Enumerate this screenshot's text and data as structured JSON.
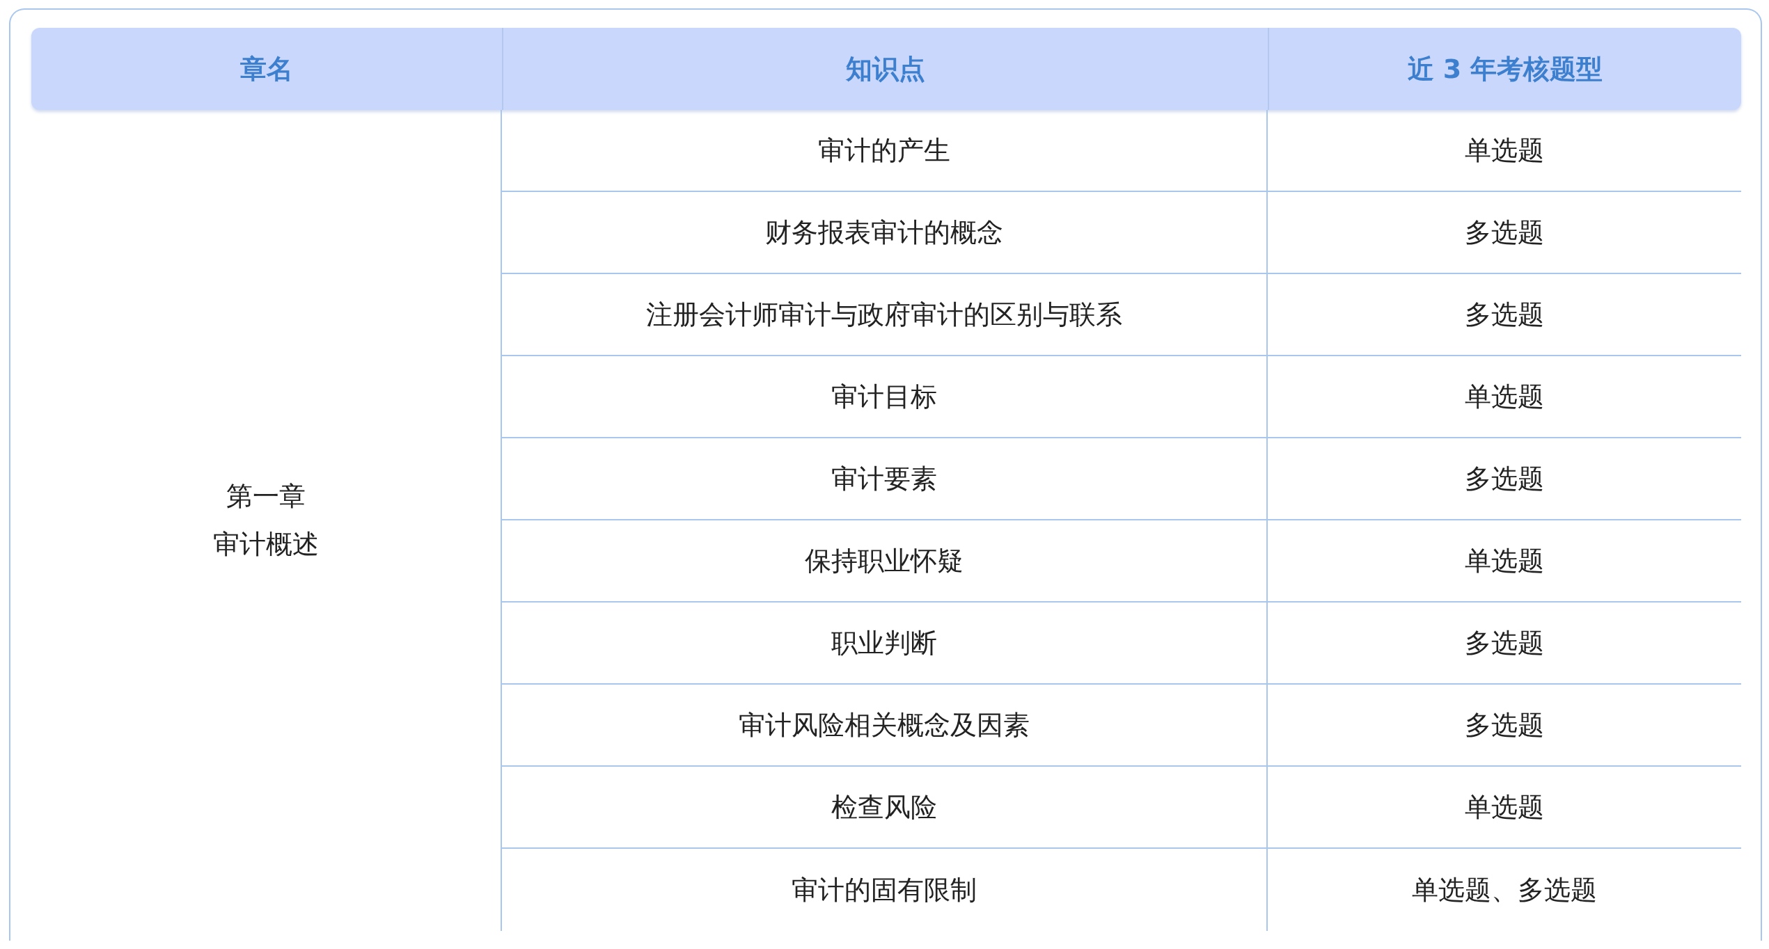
{
  "table": {
    "columns": [
      "章名",
      "知识点",
      "近 3 年考核题型"
    ],
    "chapter": {
      "number": "第一章",
      "title": "审计概述"
    },
    "rows": [
      {
        "topic": "审计的产生",
        "question_type": "单选题"
      },
      {
        "topic": "财务报表审计的概念",
        "question_type": "多选题"
      },
      {
        "topic": "注册会计师审计与政府审计的区别与联系",
        "question_type": "多选题"
      },
      {
        "topic": "审计目标",
        "question_type": "单选题"
      },
      {
        "topic": "审计要素",
        "question_type": "多选题"
      },
      {
        "topic": "保持职业怀疑",
        "question_type": "单选题"
      },
      {
        "topic": "职业判断",
        "question_type": "多选题"
      },
      {
        "topic": "审计风险相关概念及因素",
        "question_type": "多选题"
      },
      {
        "topic": "检查风险",
        "question_type": "单选题"
      },
      {
        "topic": "审计的固有限制",
        "question_type": "单选题、多选题"
      }
    ]
  }
}
